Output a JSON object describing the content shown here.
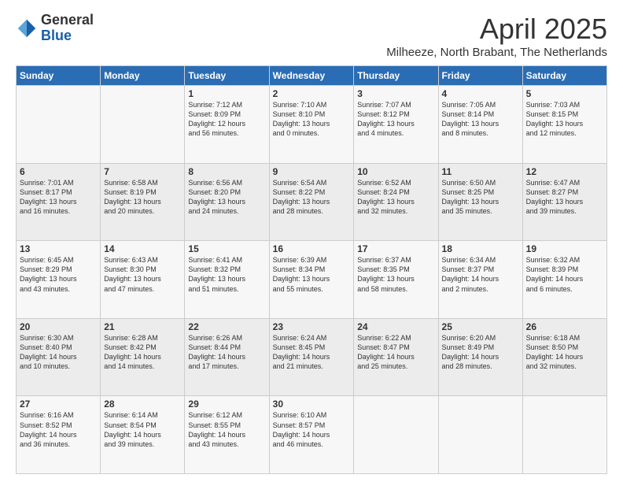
{
  "logo": {
    "general": "General",
    "blue": "Blue"
  },
  "title": {
    "month_year": "April 2025",
    "location": "Milheeze, North Brabant, The Netherlands"
  },
  "weekdays": [
    "Sunday",
    "Monday",
    "Tuesday",
    "Wednesday",
    "Thursday",
    "Friday",
    "Saturday"
  ],
  "weeks": [
    [
      {
        "day": "",
        "info": ""
      },
      {
        "day": "",
        "info": ""
      },
      {
        "day": "1",
        "info": "Sunrise: 7:12 AM\nSunset: 8:09 PM\nDaylight: 12 hours\nand 56 minutes."
      },
      {
        "day": "2",
        "info": "Sunrise: 7:10 AM\nSunset: 8:10 PM\nDaylight: 13 hours\nand 0 minutes."
      },
      {
        "day": "3",
        "info": "Sunrise: 7:07 AM\nSunset: 8:12 PM\nDaylight: 13 hours\nand 4 minutes."
      },
      {
        "day": "4",
        "info": "Sunrise: 7:05 AM\nSunset: 8:14 PM\nDaylight: 13 hours\nand 8 minutes."
      },
      {
        "day": "5",
        "info": "Sunrise: 7:03 AM\nSunset: 8:15 PM\nDaylight: 13 hours\nand 12 minutes."
      }
    ],
    [
      {
        "day": "6",
        "info": "Sunrise: 7:01 AM\nSunset: 8:17 PM\nDaylight: 13 hours\nand 16 minutes."
      },
      {
        "day": "7",
        "info": "Sunrise: 6:58 AM\nSunset: 8:19 PM\nDaylight: 13 hours\nand 20 minutes."
      },
      {
        "day": "8",
        "info": "Sunrise: 6:56 AM\nSunset: 8:20 PM\nDaylight: 13 hours\nand 24 minutes."
      },
      {
        "day": "9",
        "info": "Sunrise: 6:54 AM\nSunset: 8:22 PM\nDaylight: 13 hours\nand 28 minutes."
      },
      {
        "day": "10",
        "info": "Sunrise: 6:52 AM\nSunset: 8:24 PM\nDaylight: 13 hours\nand 32 minutes."
      },
      {
        "day": "11",
        "info": "Sunrise: 6:50 AM\nSunset: 8:25 PM\nDaylight: 13 hours\nand 35 minutes."
      },
      {
        "day": "12",
        "info": "Sunrise: 6:47 AM\nSunset: 8:27 PM\nDaylight: 13 hours\nand 39 minutes."
      }
    ],
    [
      {
        "day": "13",
        "info": "Sunrise: 6:45 AM\nSunset: 8:29 PM\nDaylight: 13 hours\nand 43 minutes."
      },
      {
        "day": "14",
        "info": "Sunrise: 6:43 AM\nSunset: 8:30 PM\nDaylight: 13 hours\nand 47 minutes."
      },
      {
        "day": "15",
        "info": "Sunrise: 6:41 AM\nSunset: 8:32 PM\nDaylight: 13 hours\nand 51 minutes."
      },
      {
        "day": "16",
        "info": "Sunrise: 6:39 AM\nSunset: 8:34 PM\nDaylight: 13 hours\nand 55 minutes."
      },
      {
        "day": "17",
        "info": "Sunrise: 6:37 AM\nSunset: 8:35 PM\nDaylight: 13 hours\nand 58 minutes."
      },
      {
        "day": "18",
        "info": "Sunrise: 6:34 AM\nSunset: 8:37 PM\nDaylight: 14 hours\nand 2 minutes."
      },
      {
        "day": "19",
        "info": "Sunrise: 6:32 AM\nSunset: 8:39 PM\nDaylight: 14 hours\nand 6 minutes."
      }
    ],
    [
      {
        "day": "20",
        "info": "Sunrise: 6:30 AM\nSunset: 8:40 PM\nDaylight: 14 hours\nand 10 minutes."
      },
      {
        "day": "21",
        "info": "Sunrise: 6:28 AM\nSunset: 8:42 PM\nDaylight: 14 hours\nand 14 minutes."
      },
      {
        "day": "22",
        "info": "Sunrise: 6:26 AM\nSunset: 8:44 PM\nDaylight: 14 hours\nand 17 minutes."
      },
      {
        "day": "23",
        "info": "Sunrise: 6:24 AM\nSunset: 8:45 PM\nDaylight: 14 hours\nand 21 minutes."
      },
      {
        "day": "24",
        "info": "Sunrise: 6:22 AM\nSunset: 8:47 PM\nDaylight: 14 hours\nand 25 minutes."
      },
      {
        "day": "25",
        "info": "Sunrise: 6:20 AM\nSunset: 8:49 PM\nDaylight: 14 hours\nand 28 minutes."
      },
      {
        "day": "26",
        "info": "Sunrise: 6:18 AM\nSunset: 8:50 PM\nDaylight: 14 hours\nand 32 minutes."
      }
    ],
    [
      {
        "day": "27",
        "info": "Sunrise: 6:16 AM\nSunset: 8:52 PM\nDaylight: 14 hours\nand 36 minutes."
      },
      {
        "day": "28",
        "info": "Sunrise: 6:14 AM\nSunset: 8:54 PM\nDaylight: 14 hours\nand 39 minutes."
      },
      {
        "day": "29",
        "info": "Sunrise: 6:12 AM\nSunset: 8:55 PM\nDaylight: 14 hours\nand 43 minutes."
      },
      {
        "day": "30",
        "info": "Sunrise: 6:10 AM\nSunset: 8:57 PM\nDaylight: 14 hours\nand 46 minutes."
      },
      {
        "day": "",
        "info": ""
      },
      {
        "day": "",
        "info": ""
      },
      {
        "day": "",
        "info": ""
      }
    ]
  ]
}
